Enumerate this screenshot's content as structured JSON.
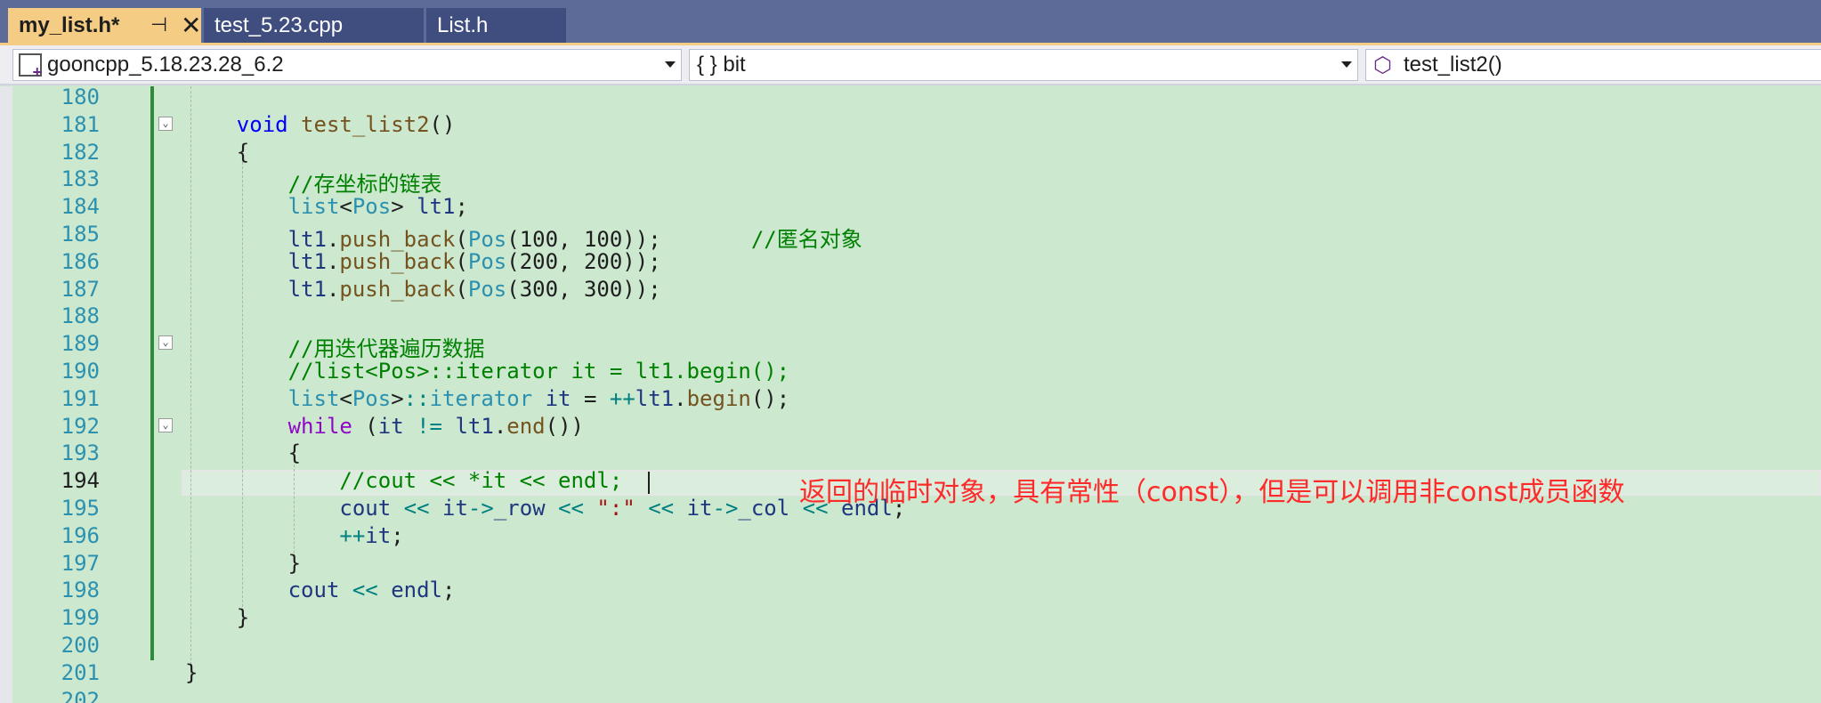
{
  "tabs": [
    {
      "label": "my_list.h*",
      "active": true
    },
    {
      "label": "test_5.23.cpp",
      "active": false
    },
    {
      "label": "List.h",
      "active": false
    }
  ],
  "navbar": {
    "project": "gooncpp_5.18.23.28_6.2",
    "scope": "{ } bit",
    "member": "test_list2()"
  },
  "editor": {
    "current_line": 194,
    "line_numbers": [
      "180",
      "181",
      "182",
      "183",
      "184",
      "185",
      "186",
      "187",
      "188",
      "189",
      "190",
      "191",
      "192",
      "193",
      "194",
      "195",
      "196",
      "197",
      "198",
      "199",
      "200",
      "201",
      "202"
    ],
    "lines": [
      "",
      "    void test_list2()",
      "    {",
      "        //存坐标的链表",
      "        list<Pos> lt1;",
      "        lt1.push_back(Pos(100, 100));       //匿名对象",
      "        lt1.push_back(Pos(200, 200));",
      "        lt1.push_back(Pos(300, 300));",
      "",
      "        //用迭代器遍历数据",
      "        //list<Pos>::iterator it = lt1.begin();",
      "        list<Pos>::iterator it = ++lt1.begin();",
      "        while (it != lt1.end())",
      "        {",
      "            //cout << *it << endl;",
      "            cout << it->_row << \":\" << it->_col << endl;",
      "            ++it;",
      "        }",
      "        cout << endl;",
      "    }",
      "",
      "}",
      ""
    ]
  },
  "annotation": "返回的临时对象，具有常性（const），但是可以调用非const成员函数",
  "colors": {
    "editor_bg": "#cce8cf",
    "keyword": "#0000ff",
    "comment": "#008000",
    "type": "#2b91af",
    "annotation": "#ff2b2b",
    "active_tab": "#f5cc84"
  }
}
